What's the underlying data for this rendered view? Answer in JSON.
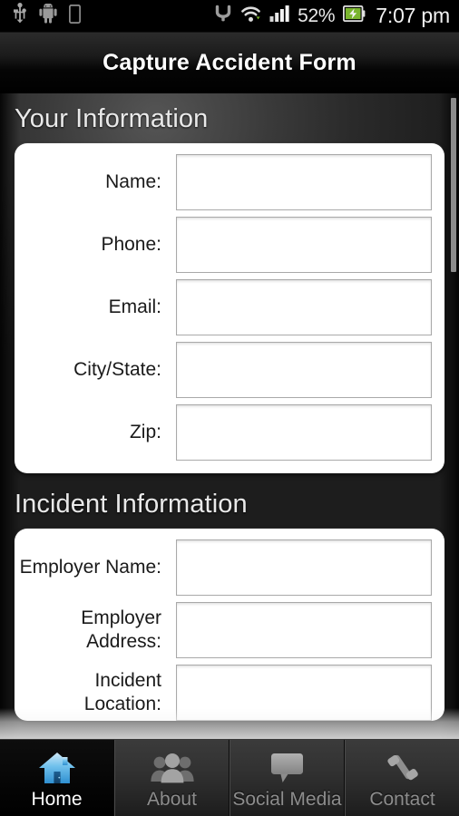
{
  "statusbar": {
    "left_icons": [
      "usb-icon",
      "android-robot-icon",
      "sd-card-icon"
    ],
    "bluetooth_icon": "bluetooth-icon",
    "wifi_icon": "wifi-icon",
    "signal_icon": "cellular-signal-icon",
    "battery_percent": "52%",
    "battery_icon": "battery-charging-icon",
    "time": "7:07 pm"
  },
  "titlebar": {
    "title": "Capture Accident Form"
  },
  "sections": [
    {
      "header": "Your Information",
      "fields": [
        {
          "label": "Name:",
          "value": "",
          "placeholder": ""
        },
        {
          "label": "Phone:",
          "value": "",
          "placeholder": ""
        },
        {
          "label": "Email:",
          "value": "",
          "placeholder": ""
        },
        {
          "label": "City/State:",
          "value": "",
          "placeholder": ""
        },
        {
          "label": "Zip:",
          "value": "",
          "placeholder": ""
        }
      ]
    },
    {
      "header": "Incident Information",
      "fields": [
        {
          "label": "Employer Name:",
          "value": "",
          "placeholder": ""
        },
        {
          "label": "Employer Address:",
          "value": "",
          "placeholder": ""
        },
        {
          "label": "Incident Location:",
          "value": "",
          "placeholder": ""
        }
      ]
    }
  ],
  "scrollbar": {
    "position_percent": 0
  },
  "tabs": [
    {
      "label": "Home",
      "icon": "home-icon",
      "active": true
    },
    {
      "label": "About",
      "icon": "people-icon",
      "active": false
    },
    {
      "label": "Social Media",
      "icon": "chat-bubble-icon",
      "active": false
    },
    {
      "label": "Contact",
      "icon": "phone-handset-icon",
      "active": false
    }
  ],
  "colors": {
    "accent": "#4aa8e0",
    "title_text": "#ffffff",
    "section_header_text": "#e9e9e9",
    "card_background": "#ffffff",
    "tab_inactive_text": "#8d8d8d",
    "statusbar_background": "#000000"
  }
}
